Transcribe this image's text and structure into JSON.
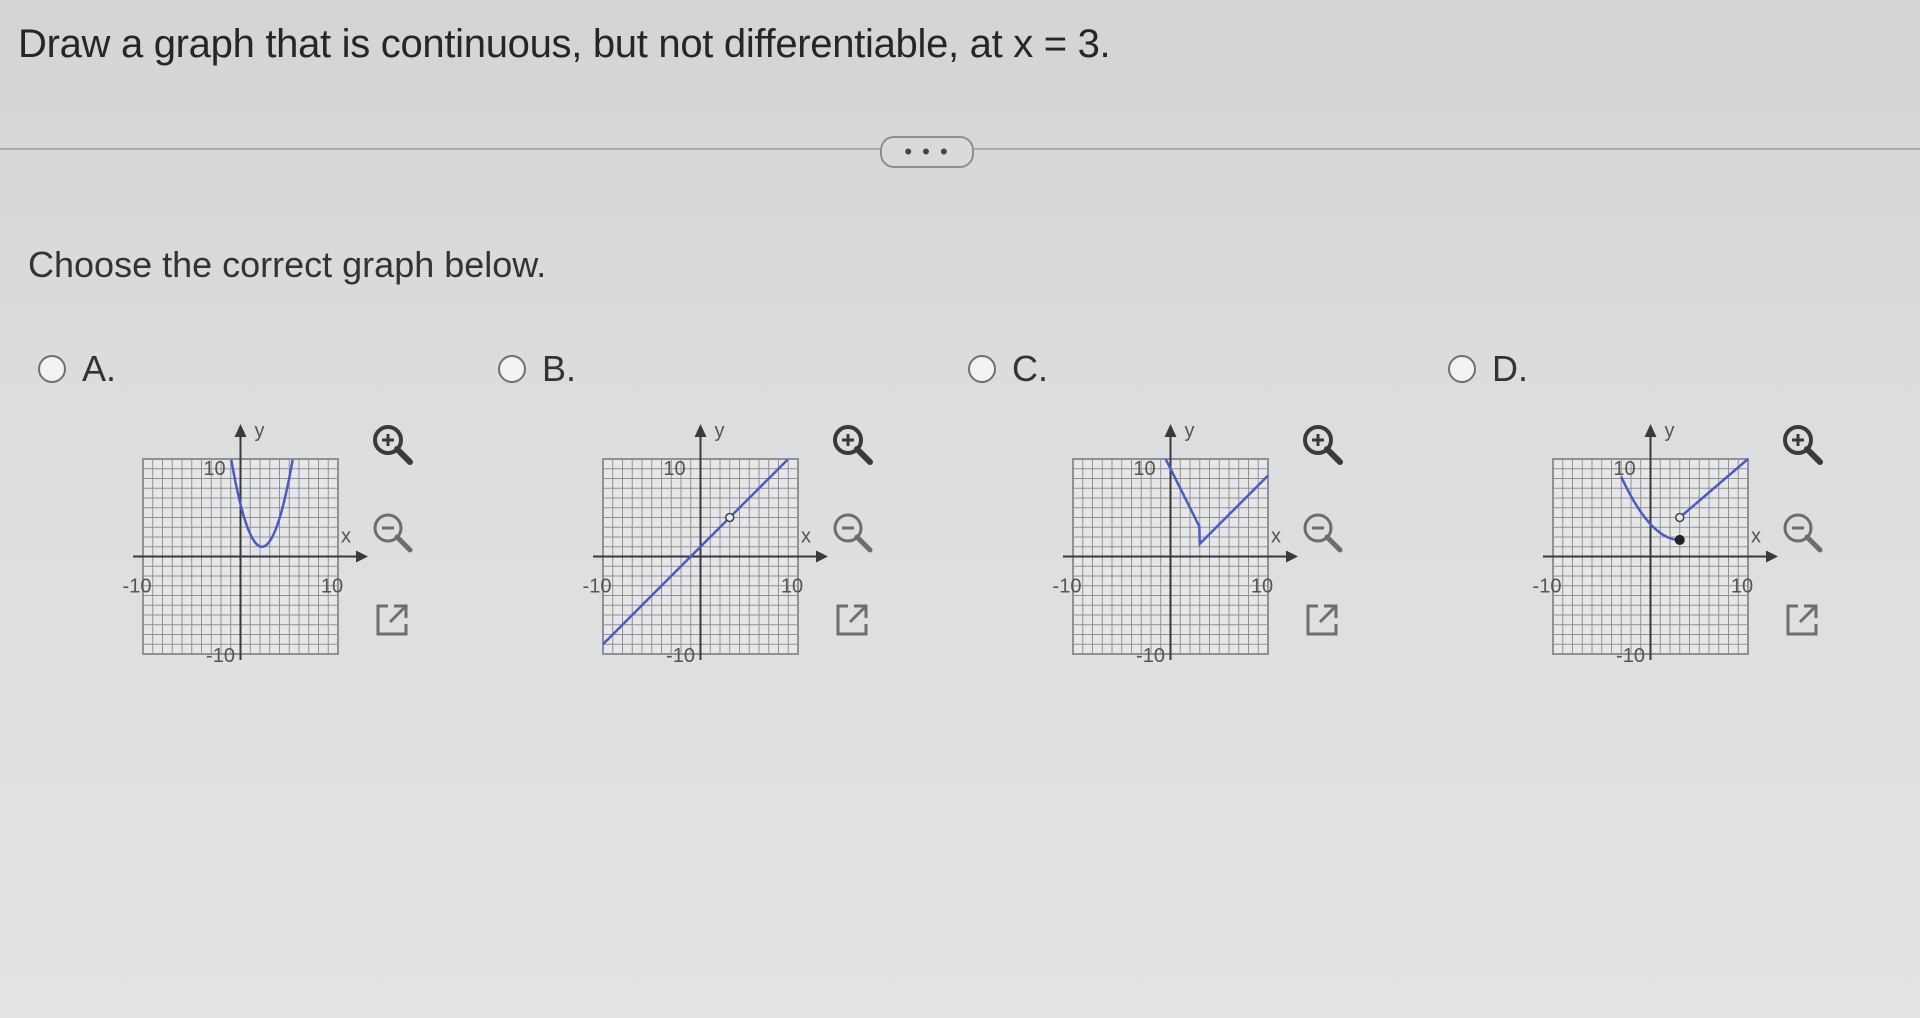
{
  "question": "Draw a graph that is continuous, but not differentiable, at x = 3.",
  "more_label": "• • •",
  "prompt": "Choose the correct graph below.",
  "axis": {
    "x_label": "x",
    "y_label": "y",
    "pos_tick": "10",
    "neg_tick": "-10"
  },
  "colors": {
    "curve": "#4a5bc4",
    "grid": "#8f9195",
    "axis": "#3a3a3a",
    "radio": "#6e7073"
  },
  "icons": [
    "zoom-in-icon",
    "zoom-out-icon",
    "open-in-new-icon"
  ],
  "options": [
    {
      "id": "A",
      "label": "A."
    },
    {
      "id": "B",
      "label": "B."
    },
    {
      "id": "C",
      "label": "C."
    },
    {
      "id": "D",
      "label": "D."
    }
  ]
}
